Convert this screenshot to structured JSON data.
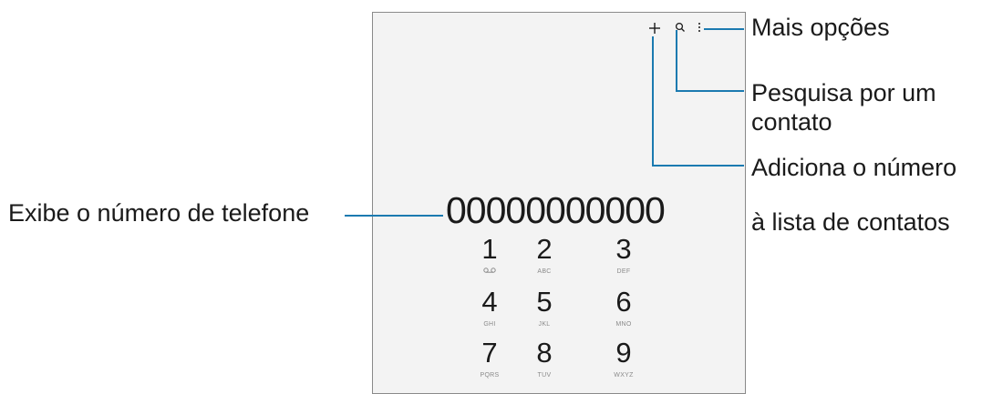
{
  "display": {
    "number": "00000000000"
  },
  "top_icons": [
    "plus-icon",
    "search-icon",
    "more-options-icon"
  ],
  "keypad": [
    {
      "digit": "1",
      "letters": "",
      "icon": "voicemail-icon"
    },
    {
      "digit": "2",
      "letters": "ABC"
    },
    {
      "digit": "3",
      "letters": "DEF"
    },
    {
      "digit": "4",
      "letters": "GHI"
    },
    {
      "digit": "5",
      "letters": "JKL"
    },
    {
      "digit": "6",
      "letters": "MNO"
    },
    {
      "digit": "7",
      "letters": "PQRS"
    },
    {
      "digit": "8",
      "letters": "TUV"
    },
    {
      "digit": "9",
      "letters": "WXYZ"
    }
  ],
  "callouts": {
    "more_options": "Mais opções",
    "search_line1": "Pesquisa por um",
    "search_line2": "contato",
    "add_line1": "Adiciona o número",
    "add_line2": "à lista de contatos",
    "number_display": "Exibe o número de telefone"
  },
  "colors": {
    "callout_line": "#1b7ab0",
    "screen_bg": "#f3f3f3",
    "frame": "#8a8a8a"
  }
}
